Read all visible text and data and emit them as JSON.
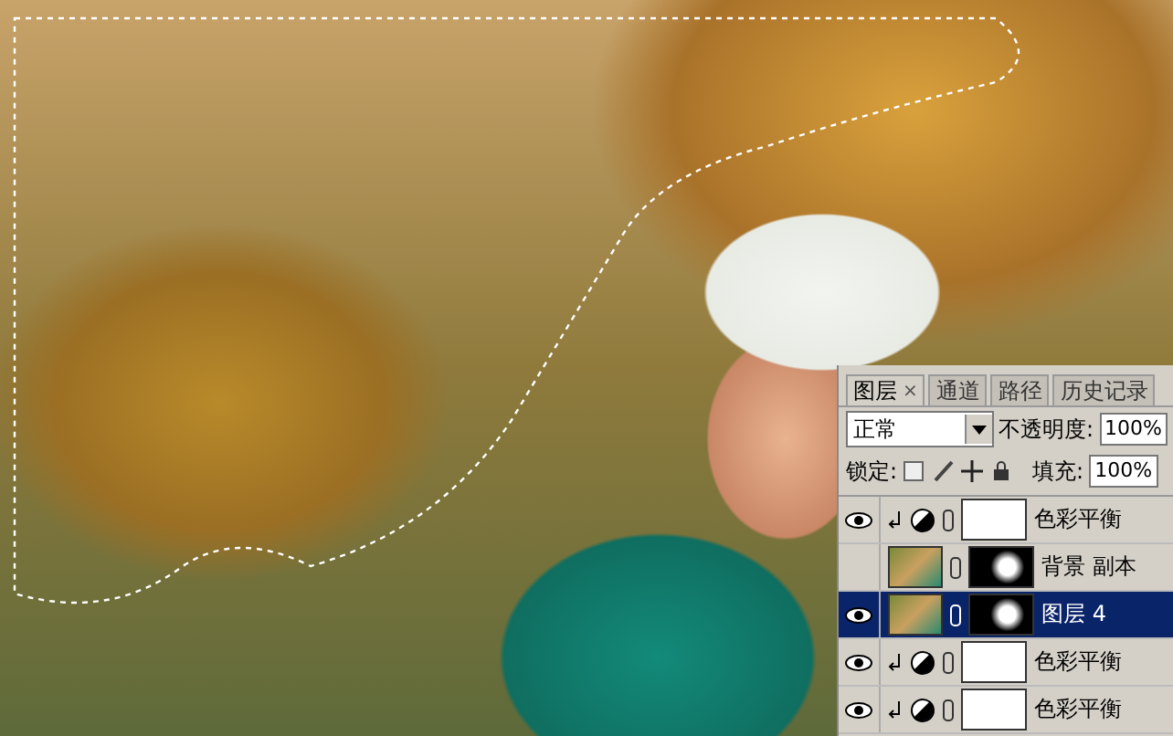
{
  "photo": {
    "selection": true
  },
  "layers_panel": {
    "tabs": [
      {
        "label": "图层",
        "selected": true,
        "close": "×"
      },
      {
        "label": "通道",
        "selected": false
      },
      {
        "label": "路径",
        "selected": false
      },
      {
        "label": "历史记录",
        "selected": false
      }
    ],
    "blend_mode": "正常",
    "opacity_label": "不透明度:",
    "opacity": "100%",
    "lock_label": "锁定:",
    "fill_label": "填充:",
    "fill": "100%",
    "layers": [
      {
        "kind": "adjustment",
        "name": "色彩平衡",
        "visible": true,
        "selected": false
      },
      {
        "kind": "image",
        "name": "背景 副本",
        "visible": false,
        "selected": false
      },
      {
        "kind": "image",
        "name": "图层 4",
        "visible": true,
        "selected": true
      },
      {
        "kind": "adjustment",
        "name": "色彩平衡",
        "visible": true,
        "selected": false
      },
      {
        "kind": "adjustment",
        "name": "色彩平衡",
        "visible": true,
        "selected": false
      }
    ]
  }
}
